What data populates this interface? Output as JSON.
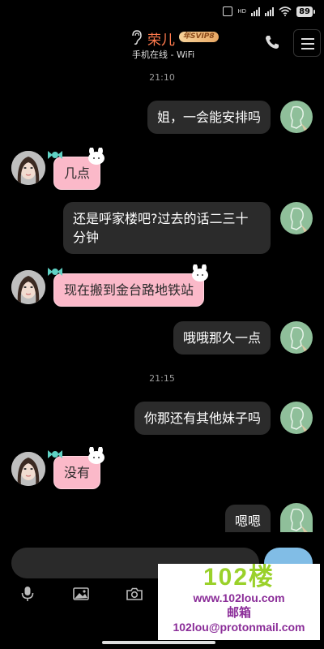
{
  "status_bar": {
    "network": "HD",
    "battery": "89"
  },
  "header": {
    "contact_name": "荣儿",
    "vip_badge": "年SVIP8",
    "online_status": "手机在线 - WiFi"
  },
  "messages": [
    {
      "type": "time",
      "text": "21:10"
    },
    {
      "type": "out",
      "text": "姐，一会能安排吗"
    },
    {
      "type": "in",
      "text": "几点"
    },
    {
      "type": "out",
      "text": "还是呼家楼吧?过去的话二三十分钟"
    },
    {
      "type": "in",
      "text": "现在搬到金台路地铁站"
    },
    {
      "type": "out",
      "text": "哦哦那久一点"
    },
    {
      "type": "time",
      "text": "21:15"
    },
    {
      "type": "out",
      "text": "你那还有其他妹子吗"
    },
    {
      "type": "in",
      "text": "没有"
    },
    {
      "type": "out",
      "text": "嗯嗯"
    }
  ],
  "toolbar": {
    "icons": [
      "microphone-icon",
      "image-icon",
      "camera-icon"
    ]
  },
  "watermark": {
    "brand": "102楼",
    "site": "www.102lou.com",
    "mail_label": "邮箱",
    "email": "102lou@protonmail.com"
  },
  "colors": {
    "name": "#ff7a4d",
    "incoming_bubble": "#fbb9c9",
    "outgoing_bubble": "#2b2b2b",
    "watermark_green": "#9ad12a",
    "watermark_purple": "#8a2c98"
  }
}
